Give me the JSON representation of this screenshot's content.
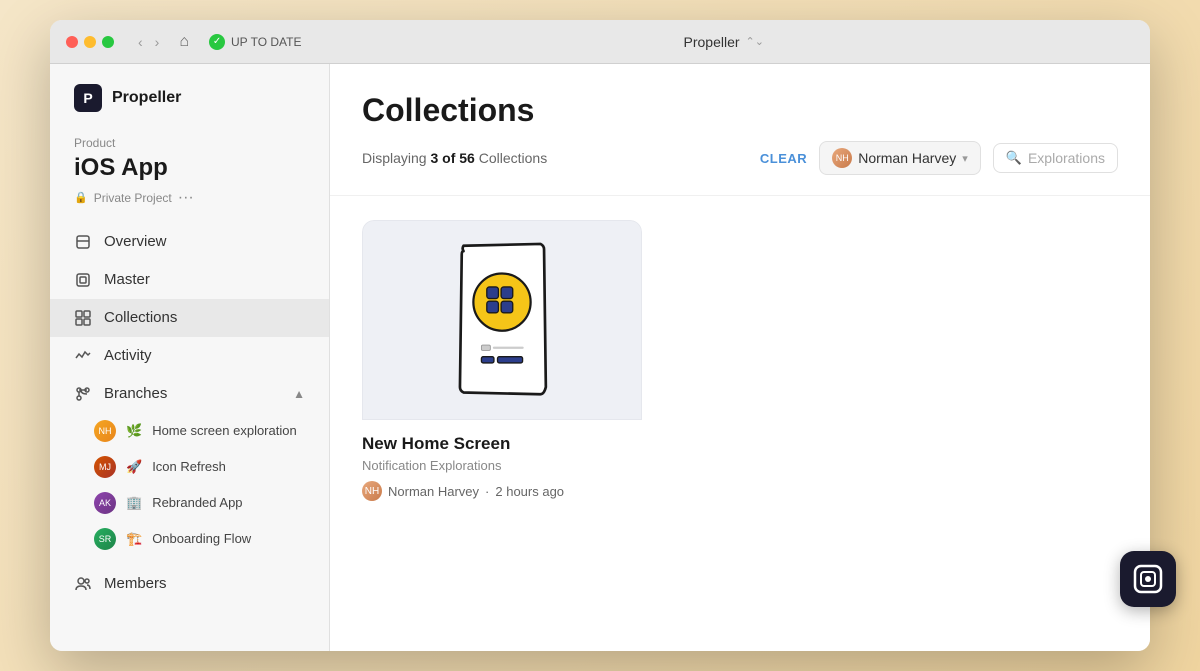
{
  "window": {
    "title": "Propeller",
    "sync_status": "UP TO DATE"
  },
  "sidebar": {
    "logo": "P",
    "app_name": "Propeller",
    "project_label": "Product",
    "project_name": "iOS App",
    "project_meta": "Private Project",
    "nav_items": [
      {
        "id": "overview",
        "label": "Overview",
        "icon": "□"
      },
      {
        "id": "master",
        "label": "Master",
        "icon": "⊡"
      },
      {
        "id": "collections",
        "label": "Collections",
        "icon": "⧉"
      },
      {
        "id": "activity",
        "label": "Activity",
        "icon": "〜"
      },
      {
        "id": "branches",
        "label": "Branches",
        "icon": "⑂"
      }
    ],
    "branches": [
      {
        "id": 1,
        "label": "Home screen exploration",
        "icon": "🌿"
      },
      {
        "id": 2,
        "label": "Icon Refresh",
        "icon": "🚀"
      },
      {
        "id": 3,
        "label": "Rebranded App",
        "icon": "🏢"
      },
      {
        "id": 4,
        "label": "Onboarding Flow",
        "icon": "🏗️"
      }
    ],
    "members_label": "Members"
  },
  "content": {
    "title": "Collections",
    "displaying_prefix": "Displaying",
    "displaying_count": "3 of 56",
    "displaying_suffix": "Collections",
    "clear_label": "CLEAR",
    "filter_user": "Norman Harvey",
    "search_placeholder": "Explorations",
    "card": {
      "title": "New Home Screen",
      "subtitle": "Notification Explorations",
      "author": "Norman Harvey",
      "time_ago": "2 hours ago"
    }
  }
}
